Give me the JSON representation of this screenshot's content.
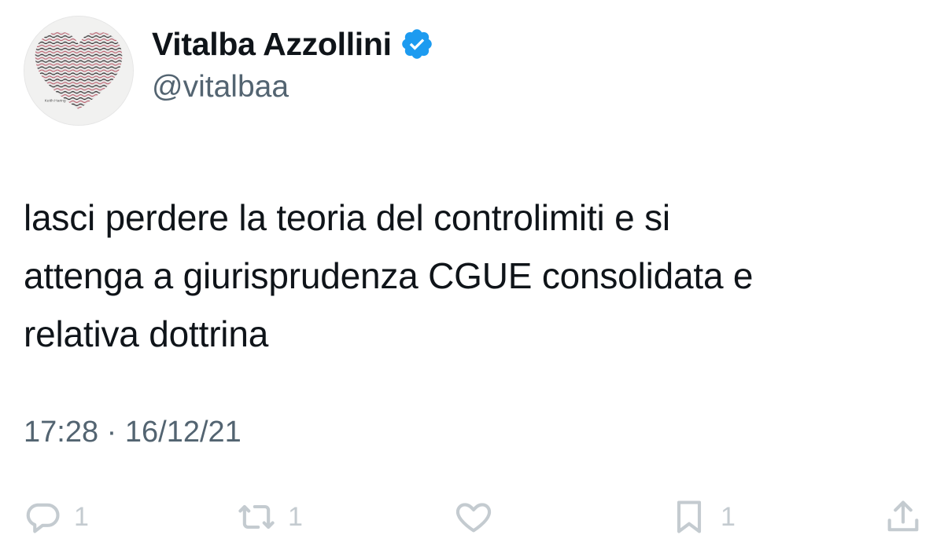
{
  "author": {
    "display_name": "Vitalba Azzollini",
    "handle": "@vitalbaa",
    "verified_icon": "verified-badge-icon",
    "avatar_icon": "heart-pattern-avatar"
  },
  "tweet": {
    "text_lines": [
      "lasci perdere la teoria del controlimiti e si",
      "attenga a giurisprudenza CGUE consolidata e",
      "relativa dottrina"
    ],
    "timestamp": "17:28 · 16/12/21"
  },
  "actions": {
    "reply": {
      "icon": "reply-icon",
      "count": "1"
    },
    "retweet": {
      "icon": "retweet-icon",
      "count": "1"
    },
    "like": {
      "icon": "heart-icon",
      "count": ""
    },
    "bookmark": {
      "icon": "bookmark-icon",
      "count": "1"
    },
    "share": {
      "icon": "share-icon",
      "count": ""
    }
  },
  "colors": {
    "text_primary": "#0f1419",
    "text_secondary": "#536471",
    "verified_blue": "#1d9bf0",
    "action_gray": "#c4cbd0"
  }
}
